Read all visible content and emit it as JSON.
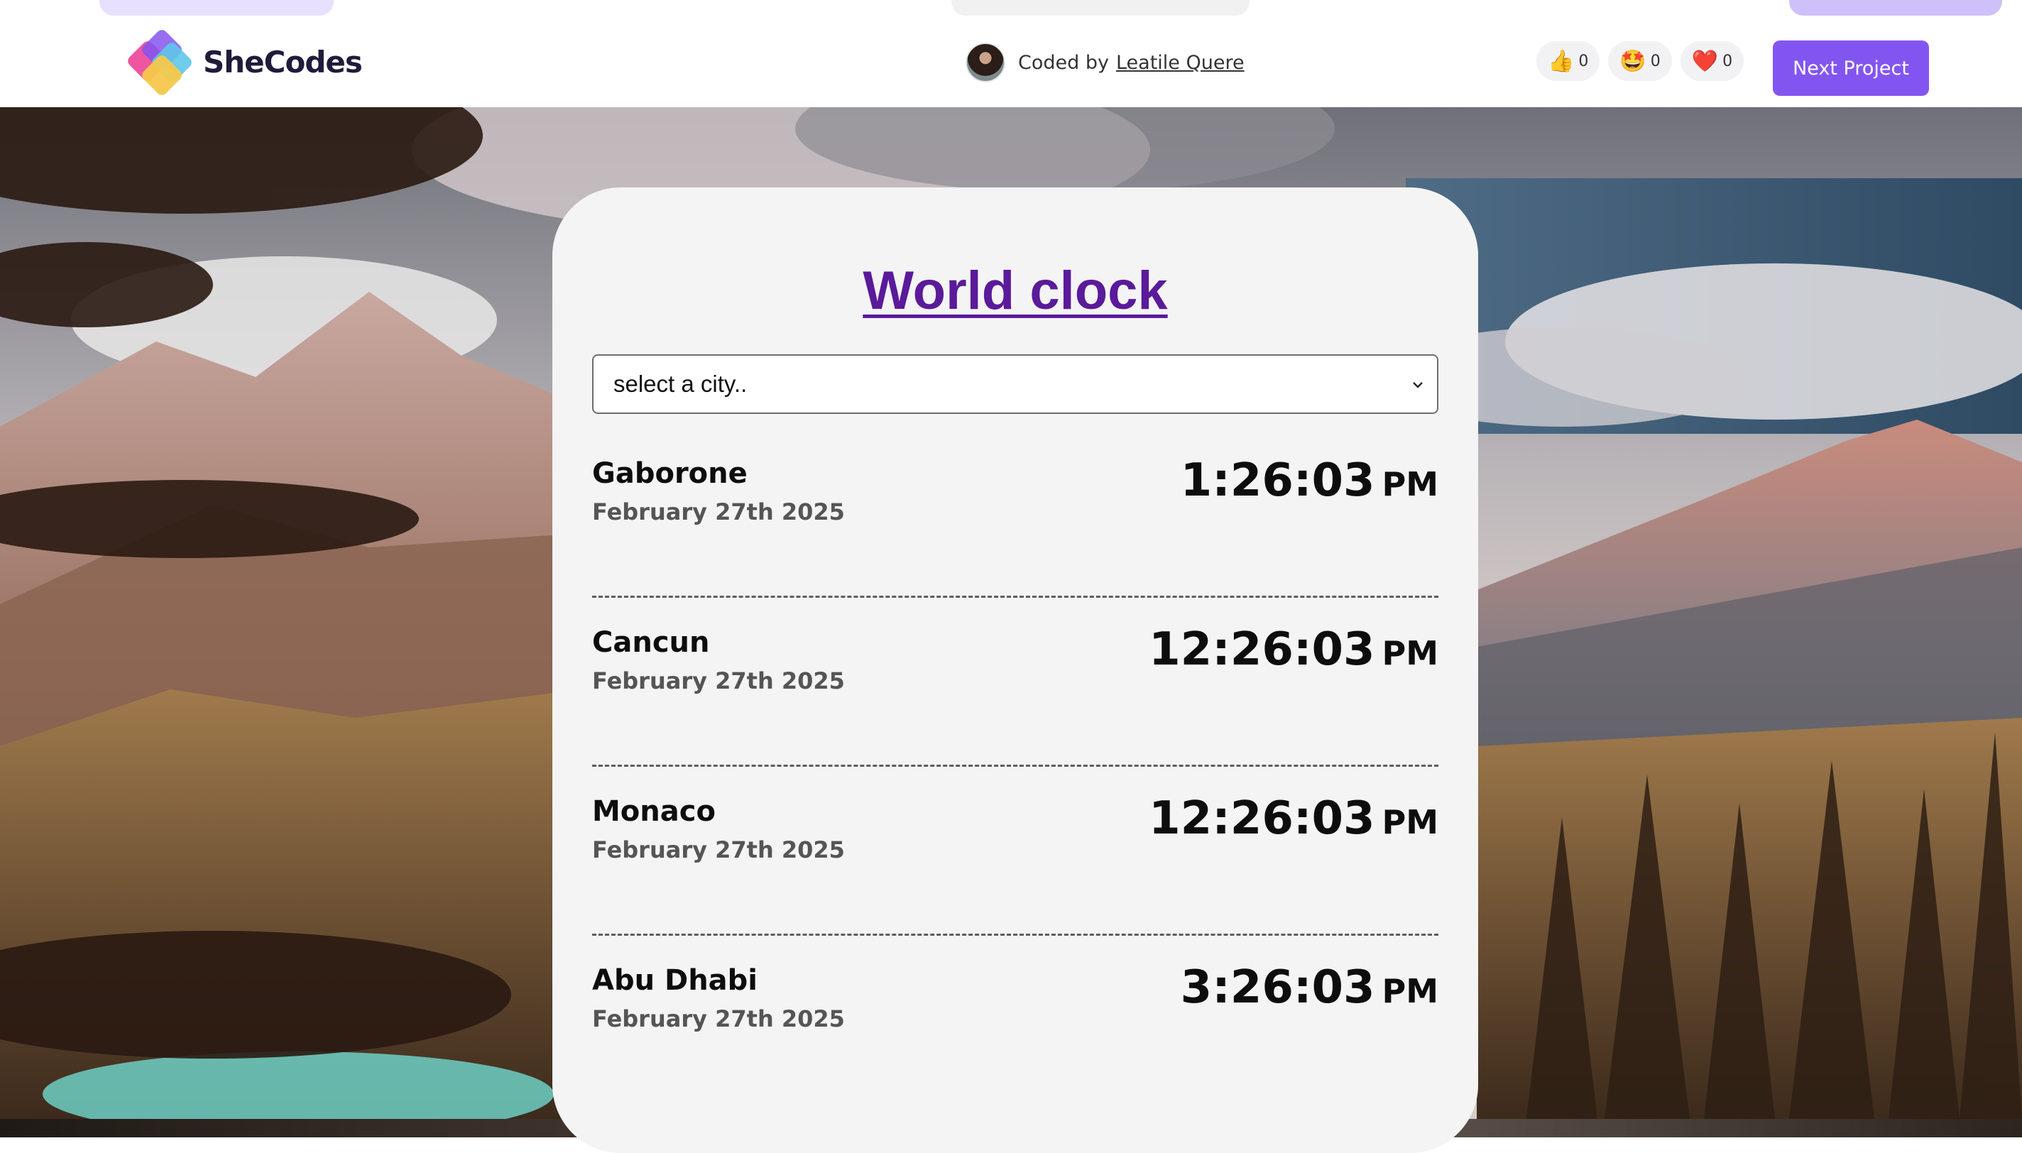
{
  "header": {
    "brand": "SheCodes",
    "coded_by_prefix": "Coded by",
    "author": "Leatile Quere",
    "reactions": [
      {
        "icon": "thumbs-up",
        "emoji": "👍",
        "count": "0"
      },
      {
        "icon": "star-struck",
        "emoji": "🤩",
        "count": "0"
      },
      {
        "icon": "heart",
        "emoji": "❤️",
        "count": "0"
      }
    ],
    "next_button": "Next Project"
  },
  "app": {
    "title": "World clock",
    "select_placeholder": "select a city..",
    "cities": [
      {
        "name": "Gaborone",
        "date": "February 27th 2025",
        "time": "1:26:03",
        "ampm": "PM"
      },
      {
        "name": "Cancun",
        "date": "February 27th 2025",
        "time": "12:26:03",
        "ampm": "PM"
      },
      {
        "name": "Monaco",
        "date": "February 27th 2025",
        "time": "12:26:03",
        "ampm": "PM"
      },
      {
        "name": "Abu Dhabi",
        "date": "February 27th 2025",
        "time": "3:26:03",
        "ampm": "PM"
      }
    ]
  },
  "colors": {
    "brand_purple": "#8355f0",
    "title_purple": "#5a1a9a",
    "card_bg": "#f4f4f4",
    "logo_pink": "#ee4c9c",
    "logo_blue": "#5fc7e8",
    "logo_yellow": "#f6c84c",
    "logo_purple": "#8355f0"
  }
}
